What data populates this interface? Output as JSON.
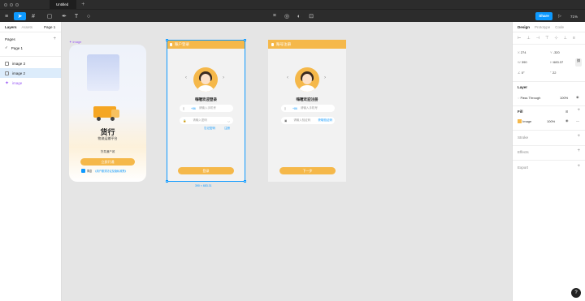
{
  "window": {
    "file_name": "Untitled",
    "new_tab": "+"
  },
  "toolbar": {
    "share_label": "Share",
    "zoom": "71%"
  },
  "left_panel": {
    "tabs": [
      "Layers",
      "Assets"
    ],
    "page_selector": "Page 1",
    "pages_header": "Pages",
    "pages": [
      {
        "label": "Page 1",
        "check": "✓"
      }
    ],
    "layers": [
      {
        "label": "image 3"
      },
      {
        "label": "image 2"
      },
      {
        "label": "image"
      }
    ]
  },
  "canvas": {
    "frame_label": "image",
    "selection_size": "390 × 683.31",
    "screen1": {
      "title": "货行",
      "subtitle": "物流运输平台",
      "tagline": "货易通产城",
      "start_button": "立即开通",
      "agree_prefix": "同意",
      "agree_link": "《用户服务协议及隐私政策》"
    },
    "screen2": {
      "header": "账户登录",
      "greeting": "嗨喔欢迎登录",
      "phone_prefix": "+86",
      "phone_placeholder": "请输入手机号",
      "password_placeholder": "请输入密码",
      "forgot": "忘记密码",
      "register": "注册",
      "button": "登录"
    },
    "screen3": {
      "header": "账号注册",
      "greeting": "嗨喔欢迎注册",
      "phone_prefix": "+86",
      "phone_placeholder": "请输入手机号",
      "code_placeholder": "请输入验证码",
      "get_code": "获取验证码",
      "button": "下一步"
    }
  },
  "right_panel": {
    "tabs": [
      "Design",
      "Prototype",
      "Code"
    ],
    "x_label": "X",
    "x": "274",
    "y_label": "Y",
    "y": "-320",
    "w_label": "W",
    "w": "390",
    "h_label": "H",
    "h": "683.37",
    "rotation": "0°",
    "radius": "22",
    "layer_header": "Layer",
    "blend": "Pass Through",
    "opacity": "100%",
    "fill_header": "Fill",
    "fill_type": "Image",
    "fill_opacity": "100%",
    "stroke_header": "Stroke",
    "effects_header": "Effects",
    "export_header": "Export"
  },
  "colors": {
    "accent": "#0d99ff",
    "brand": "#f5b84a",
    "dark": "#2c2c2c"
  }
}
